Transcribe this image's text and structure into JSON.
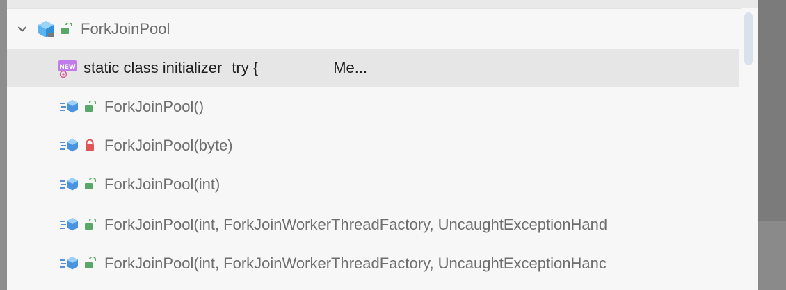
{
  "tree": {
    "root": {
      "label": "ForkJoinPool",
      "expanded": true,
      "icon": "class-icon",
      "visibility_icon": "public-lock-icon"
    },
    "children": [
      {
        "label": "static class initializer",
        "detail": "try {",
        "trailing": "Me...",
        "icon": "new-badge-icon",
        "selected": true
      },
      {
        "label": "ForkJoinPool()",
        "icon": "constructor-icon",
        "visibility_icon": "public-lock-icon",
        "selected": false
      },
      {
        "label": "ForkJoinPool(byte)",
        "icon": "constructor-icon",
        "visibility_icon": "private-lock-icon",
        "selected": false
      },
      {
        "label": "ForkJoinPool(int)",
        "icon": "constructor-icon",
        "visibility_icon": "public-lock-icon",
        "selected": false
      },
      {
        "label": "ForkJoinPool(int, ForkJoinWorkerThreadFactory, UncaughtExceptionHand",
        "icon": "constructor-icon",
        "visibility_icon": "public-lock-icon",
        "selected": false
      },
      {
        "label": "ForkJoinPool(int, ForkJoinWorkerThreadFactory, UncaughtExceptionHanc",
        "icon": "constructor-icon",
        "visibility_icon": "public-lock-icon",
        "selected": false
      }
    ]
  },
  "colors": {
    "panel_bg": "#f7f7f7",
    "selected_bg": "#e6e6e6",
    "text_muted": "#6e6e6e",
    "text_selected": "#1f1f1f",
    "class_icon": "#3d9be9",
    "public_lock": "#59a869",
    "private_lock": "#e05555",
    "new_badge": "#b56be0",
    "scroll_thumb": "#d9e2ec"
  }
}
